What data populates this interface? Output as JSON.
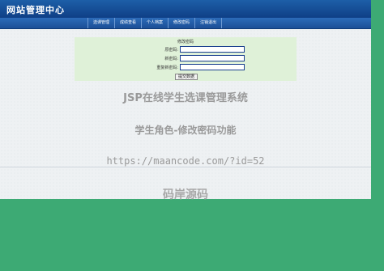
{
  "header": {
    "site_title": "网站管理中心"
  },
  "nav": {
    "items": [
      {
        "label": "选课管理"
      },
      {
        "label": "成绩查看"
      },
      {
        "label": "个人档案"
      },
      {
        "label": "修改密码"
      },
      {
        "label": "注销退出"
      }
    ]
  },
  "form": {
    "title": "修改密码",
    "fields": [
      {
        "label": "原密码:",
        "value": ""
      },
      {
        "label": "新密码:",
        "value": ""
      },
      {
        "label": "重复新密码:",
        "value": ""
      }
    ],
    "submit_label": "提交数据"
  },
  "watermark": {
    "title": "JSP在线学生选课管理系统",
    "subtitle": "学生角色-修改密码功能",
    "url": "https://maancode.com/?id=52",
    "brand": "码岸源码"
  },
  "colors": {
    "header_blue": "#1d5fa8",
    "form_bg": "#dff1d8",
    "outer_green": "#3daa74"
  }
}
